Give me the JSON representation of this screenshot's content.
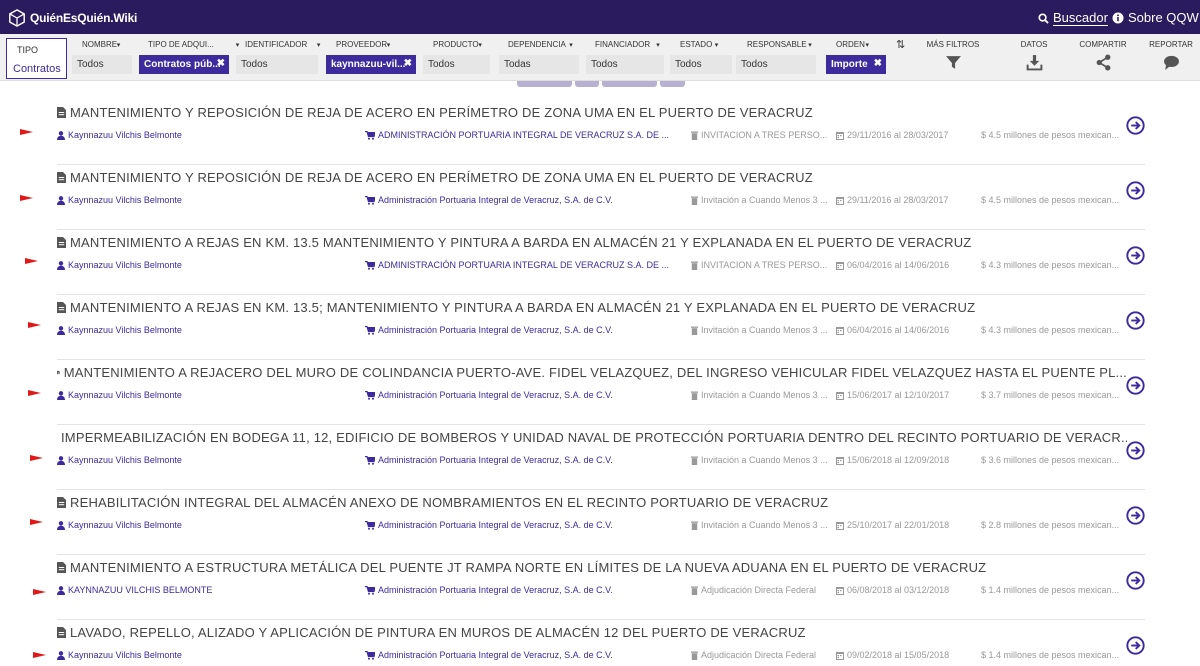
{
  "brand": {
    "name": "QuiénEsQuién.Wiki"
  },
  "topnav": {
    "buscador": "Buscador",
    "sobre": "Sobre QQW"
  },
  "filters": {
    "tipo": {
      "label": "TIPO",
      "value": "Contratos"
    },
    "items": [
      {
        "label": "NOMBRE",
        "value": "Todos",
        "selected": false
      },
      {
        "label": "TIPO DE ADQUI...",
        "value": "Contratos púb...",
        "selected": true
      },
      {
        "label": "IDENTIFICADOR",
        "value": "Todos",
        "selected": false
      },
      {
        "label": "PROVEEDOR",
        "value": "kaynnazuu-vil...",
        "selected": true
      },
      {
        "label": "PRODUCTO",
        "value": "Todos",
        "selected": false
      },
      {
        "label": "DEPENDENCIA",
        "value": "Todas",
        "selected": false
      },
      {
        "label": "FINANCIADOR",
        "value": "Todos",
        "selected": false
      },
      {
        "label": "ESTADO",
        "value": "Todos",
        "selected": false
      },
      {
        "label": "RESPONSABLE",
        "value": "Todos",
        "selected": false
      },
      {
        "label": "ORDEN",
        "value": "Importe",
        "selected": true
      }
    ]
  },
  "tools": {
    "mas_filtros": "MÁS FILTROS",
    "datos": "DATOS",
    "compartir": "COMPARTIR",
    "reportar": "REPORTAR"
  },
  "colors": {
    "brand_dark": "#2a1a5e",
    "accent": "#3d2b9e",
    "flag": "#e21818"
  },
  "results": [
    {
      "title": "MANTENIMIENTO Y REPOSICIÓN DE REJA DE ACERO EN PERÍMETRO DE ZONA UMA EN EL PUERTO DE VERACRUZ",
      "supplier": "Kaynnazuu Vilchis Belmonte",
      "buyer": "ADMINISTRACIÓN PORTUARIA INTEGRAL DE VERACRUZ S.A. DE ...",
      "procedure": "INVITACION A TRES PERSO...",
      "dates": "29/11/2016 al 28/03/2017",
      "amount": "$ 4.5 millones de pesos mexican..."
    },
    {
      "title": "MANTENIMIENTO Y REPOSICIÓN DE REJA DE ACERO EN PERÍMETRO DE ZONA UMA EN EL PUERTO DE VERACRUZ",
      "supplier": "Kaynnazuu Vilchis Belmonte",
      "buyer": "Administración Portuaria Integral de Veracruz, S.A. de C.V.",
      "procedure": "Invitación a Cuando Menos 3 ...",
      "dates": "29/11/2016 al 28/03/2017",
      "amount": "$ 4.5 millones de pesos mexican..."
    },
    {
      "title": "MANTENIMIENTO A REJAS EN KM. 13.5 MANTENIMIENTO Y PINTURA A BARDA EN ALMACÉN 21 Y EXPLANADA EN EL PUERTO DE VERACRUZ",
      "supplier": "Kaynnazuu Vilchis Belmonte",
      "buyer": "ADMINISTRACIÓN PORTUARIA INTEGRAL DE VERACRUZ S.A. DE ...",
      "procedure": "INVITACION A TRES PERSO...",
      "dates": "06/04/2016 al 14/06/2016",
      "amount": "$ 4.3 millones de pesos mexican..."
    },
    {
      "title": "MANTENIMIENTO A REJAS EN KM. 13.5; MANTENIMIENTO Y PINTURA A BARDA EN ALMACÉN 21 Y EXPLANADA EN EL PUERTO DE VERACRUZ",
      "supplier": "Kaynnazuu Vilchis Belmonte",
      "buyer": "Administración Portuaria Integral de Veracruz, S.A. de C.V.",
      "procedure": "Invitación a Cuando Menos 3 ...",
      "dates": "06/04/2016 al 14/06/2016",
      "amount": "$ 4.3 millones de pesos mexican..."
    },
    {
      "title": "MANTENIMIENTO A REJACERO DEL MURO DE COLINDANCIA PUERTO-AVE. FIDEL VELAZQUEZ, DEL INGRESO VEHICULAR FIDEL VELAZQUEZ HASTA EL PUENTE PL...",
      "supplier": "Kaynnazuu Vilchis Belmonte",
      "buyer": "Administración Portuaria Integral de Veracruz, S.A. de C.V.",
      "procedure": "Invitación a Cuando Menos 3 ...",
      "dates": "15/06/2017 al 12/10/2017",
      "amount": "$ 3.7 millones de pesos mexican..."
    },
    {
      "title": "IMPERMEABILIZACIÓN EN BODEGA 11, 12, EDIFICIO DE BOMBEROS Y UNIDAD NAVAL DE PROTECCIÓN PORTUARIA DENTRO DEL RECINTO PORTUARIO DE VERACR...",
      "supplier": "Kaynnazuu Vilchis Belmonte",
      "buyer": "Administración Portuaria Integral de Veracruz, S.A. de C.V.",
      "procedure": "Invitación a Cuando Menos 3 ...",
      "dates": "15/06/2018 al 12/09/2018",
      "amount": "$ 3.6 millones de pesos mexican..."
    },
    {
      "title": "REHABILITACIÓN INTEGRAL DEL ALMACÉN ANEXO DE NOMBRAMIENTOS EN EL RECINTO PORTUARIO DE VERACRUZ",
      "supplier": "Kaynnazuu Vilchis Belmonte",
      "buyer": "Administración Portuaria Integral de Veracruz, S.A. de C.V.",
      "procedure": "Invitación a Cuando Menos 3 ...",
      "dates": "25/10/2017 al 22/01/2018",
      "amount": "$ 2.8 millones de pesos mexican..."
    },
    {
      "title": "MANTENIMIENTO A ESTRUCTURA METÁLICA DEL PUENTE JT RAMPA NORTE EN LÍMITES DE LA NUEVA ADUANA EN EL PUERTO DE VERACRUZ",
      "supplier": "KAYNNAZUU VILCHIS BELMONTE",
      "buyer": "Administración Portuaria Integral de Veracruz, S.A. de C.V.",
      "procedure": "Adjudicación Directa Federal",
      "dates": "06/08/2018 al 03/12/2018",
      "amount": "$ 1.4 millones de pesos mexican..."
    },
    {
      "title": "LAVADO, REPELLO, ALIZADO Y APLICACIÓN DE PINTURA EN MUROS DE ALMACÉN 12 DEL PUERTO DE VERACRUZ",
      "supplier": "Kaynnazuu Vilchis Belmonte",
      "buyer": "Administración Portuaria Integral de Veracruz, S.A. de C.V.",
      "procedure": "Adjudicación Directa Federal",
      "dates": "09/02/2018 al 15/05/2018",
      "amount": "$ 1.4 millones de pesos mexican..."
    }
  ]
}
